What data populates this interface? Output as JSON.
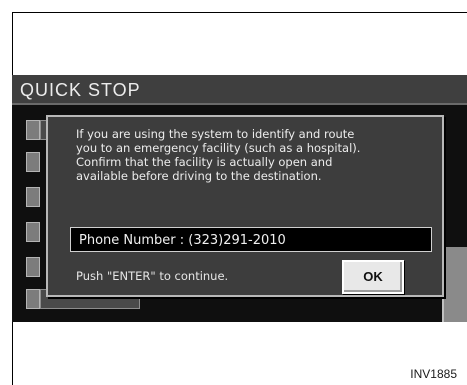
{
  "screen": {
    "title": "QUICK STOP"
  },
  "dialog": {
    "message_lines": [
      "If you are using the system to identify and route",
      "you to an emergency facility (such as a hospital).",
      "Confirm that the facility is actually open and",
      "available before driving to the destination."
    ],
    "phone_label": "Phone Number : (323)291-2010",
    "push_text": "Push \"ENTER\" to continue.",
    "ok_label": "OK"
  },
  "figure_code": "INV1885"
}
